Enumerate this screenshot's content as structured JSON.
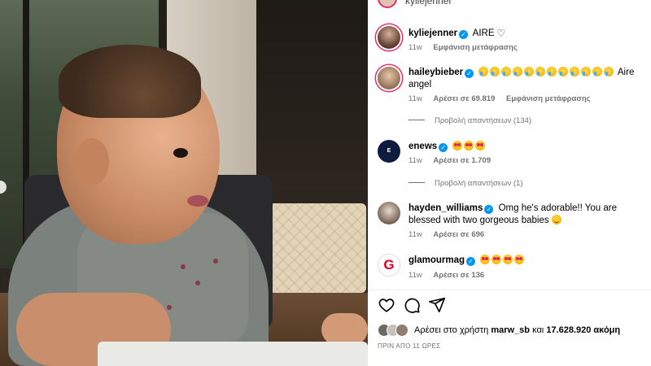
{
  "top": {
    "username": "kyliejenner"
  },
  "caption": {
    "username": "kyliejenner",
    "text": "AIRE",
    "time": "11w",
    "translate": "Εμφάνιση μετάφρασης"
  },
  "comments": [
    {
      "username": "haileybieber",
      "text": "Aire angel",
      "time": "11w",
      "likes": "Αρέσει σε 69.819",
      "translate": "Εμφάνιση μετάφρασης",
      "replies": "Προβολή απαντήσεων (134)"
    },
    {
      "username": "enews",
      "text": "",
      "time": "11w",
      "likes": "Αρέσει σε 1.709",
      "replies": "Προβολή απαντήσεων (1)"
    },
    {
      "username": "hayden_williams",
      "text": "Omg he's adorable!! You are blessed with two gorgeous babies",
      "time": "11w",
      "likes": "Αρέσει σε 696"
    },
    {
      "username": "glamourmag",
      "text": "",
      "time": "11w",
      "likes": "Αρέσει σε 136"
    }
  ],
  "liked_by": {
    "prefix": "Αρέσει στο χρήστη",
    "user": "marw_sb",
    "and": "και",
    "count": "17.628.920 ακόμη"
  },
  "posted": "ΠΡΙΝ ΑΠΟ 11 ΩΡΕΣ",
  "colors": {
    "accent": "#0095f6",
    "story_ring": "#e1306c",
    "muted": "#737373"
  },
  "icons": [
    "heart-icon",
    "comment-icon",
    "share-icon",
    "verified-badge-icon"
  ]
}
